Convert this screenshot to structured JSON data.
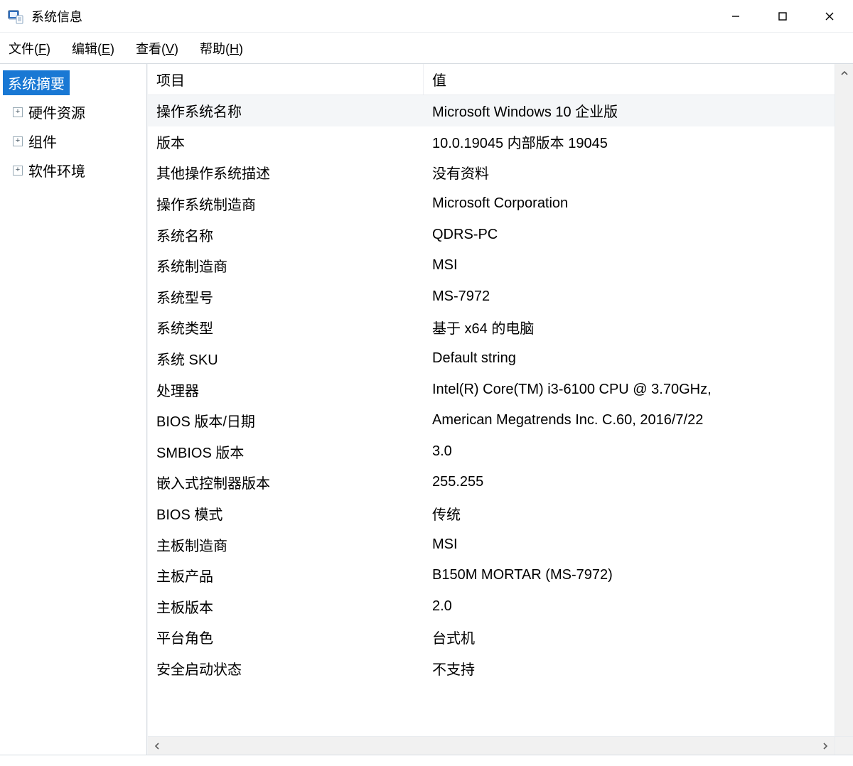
{
  "window": {
    "title": "系统信息"
  },
  "menubar": {
    "file_label": "文件",
    "file_mnemonic": "F",
    "edit_label": "编辑",
    "edit_mnemonic": "E",
    "view_label": "查看",
    "view_mnemonic": "V",
    "help_label": "帮助",
    "help_mnemonic": "H"
  },
  "tree": {
    "root_label": "系统摘要",
    "nodes": [
      {
        "expander": "+",
        "label": "硬件资源"
      },
      {
        "expander": "+",
        "label": "组件"
      },
      {
        "expander": "+",
        "label": "软件环境"
      }
    ]
  },
  "list": {
    "header": {
      "item_label": "项目",
      "value_label": "值"
    },
    "selected_index": 0,
    "rows": [
      {
        "item": "操作系统名称",
        "value": "Microsoft Windows 10 企业版"
      },
      {
        "item": "版本",
        "value": "10.0.19045 内部版本 19045"
      },
      {
        "item": "其他操作系统描述",
        "value": "没有资料"
      },
      {
        "item": "操作系统制造商",
        "value": "Microsoft Corporation"
      },
      {
        "item": "系统名称",
        "value": "QDRS-PC"
      },
      {
        "item": "系统制造商",
        "value": "MSI"
      },
      {
        "item": "系统型号",
        "value": "MS-7972"
      },
      {
        "item": "系统类型",
        "value": "基于 x64 的电脑"
      },
      {
        "item": "系统 SKU",
        "value": "Default string"
      },
      {
        "item": "处理器",
        "value": "Intel(R) Core(TM) i3-6100 CPU @ 3.70GHz,"
      },
      {
        "item": "BIOS 版本/日期",
        "value": "American Megatrends Inc. C.60, 2016/7/22"
      },
      {
        "item": "SMBIOS 版本",
        "value": "3.0"
      },
      {
        "item": "嵌入式控制器版本",
        "value": "255.255"
      },
      {
        "item": "BIOS 模式",
        "value": "传统"
      },
      {
        "item": "主板制造商",
        "value": "MSI"
      },
      {
        "item": "主板产品",
        "value": "B150M MORTAR (MS-7972)"
      },
      {
        "item": "主板版本",
        "value": "2.0"
      },
      {
        "item": "平台角色",
        "value": "台式机"
      },
      {
        "item": "安全启动状态",
        "value": "不支持"
      }
    ]
  }
}
